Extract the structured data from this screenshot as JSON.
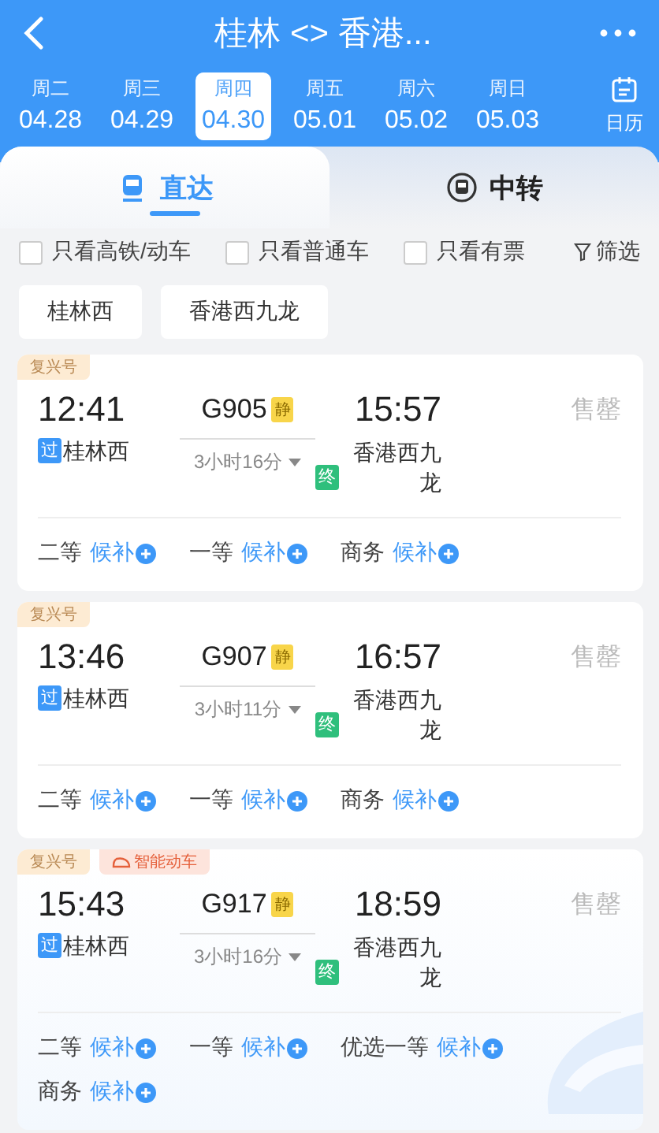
{
  "header": {
    "title": "桂林 <> 香港..."
  },
  "dates": [
    {
      "weekday": "周二",
      "date": "04.28",
      "selected": false
    },
    {
      "weekday": "周三",
      "date": "04.29",
      "selected": false
    },
    {
      "weekday": "周四",
      "date": "04.30",
      "selected": true
    },
    {
      "weekday": "周五",
      "date": "05.01",
      "selected": false
    },
    {
      "weekday": "周六",
      "date": "05.02",
      "selected": false
    },
    {
      "weekday": "周日",
      "date": "05.03",
      "selected": false
    }
  ],
  "calendar_label": "日历",
  "tabs": [
    {
      "label": "直达",
      "selected": true
    },
    {
      "label": "中转",
      "selected": false
    }
  ],
  "filters": [
    {
      "label": "只看高铁/动车",
      "checked": false
    },
    {
      "label": "只看普通车",
      "checked": false
    },
    {
      "label": "只看有票",
      "checked": false
    }
  ],
  "filter_button": "筛选",
  "stations": [
    "桂林西",
    "香港西九龙"
  ],
  "trains": [
    {
      "tags": [
        {
          "kind": "brand",
          "label": "复兴号"
        }
      ],
      "depart_time": "12:41",
      "train_no": "G905",
      "quiet_badge": "静",
      "arrive_time": "15:57",
      "from_badge": "过",
      "from": "桂林西",
      "duration": "3小时16分",
      "to_badge": "终",
      "to": "香港西九龙",
      "status": "售罄",
      "decor": false,
      "seats": [
        {
          "class": "二等",
          "action": "候补"
        },
        {
          "class": "一等",
          "action": "候补"
        },
        {
          "class": "商务",
          "action": "候补"
        }
      ]
    },
    {
      "tags": [
        {
          "kind": "brand",
          "label": "复兴号"
        }
      ],
      "depart_time": "13:46",
      "train_no": "G907",
      "quiet_badge": "静",
      "arrive_time": "16:57",
      "from_badge": "过",
      "from": "桂林西",
      "duration": "3小时11分",
      "to_badge": "终",
      "to": "香港西九龙",
      "status": "售罄",
      "decor": false,
      "seats": [
        {
          "class": "二等",
          "action": "候补"
        },
        {
          "class": "一等",
          "action": "候补"
        },
        {
          "class": "商务",
          "action": "候补"
        }
      ]
    },
    {
      "tags": [
        {
          "kind": "brand",
          "label": "复兴号"
        },
        {
          "kind": "smart",
          "label": "智能动车"
        }
      ],
      "depart_time": "15:43",
      "train_no": "G917",
      "quiet_badge": "静",
      "arrive_time": "18:59",
      "from_badge": "过",
      "from": "桂林西",
      "duration": "3小时16分",
      "to_badge": "终",
      "to": "香港西九龙",
      "status": "售罄",
      "decor": true,
      "seats": [
        {
          "class": "二等",
          "action": "候补"
        },
        {
          "class": "一等",
          "action": "候补"
        },
        {
          "class": "优选一等",
          "action": "候补"
        },
        {
          "class": "商务",
          "action": "候补"
        }
      ]
    }
  ]
}
